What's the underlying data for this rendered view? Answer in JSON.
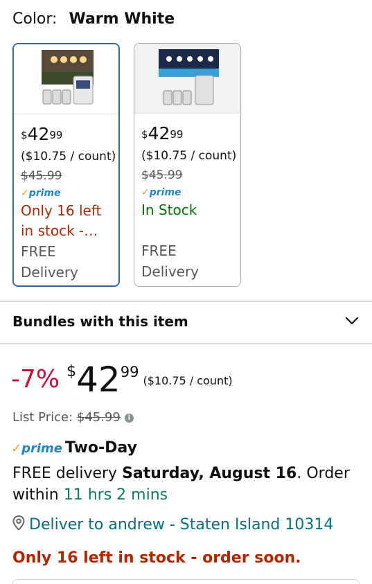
{
  "color": {
    "label": "Color:",
    "value": "Warm White"
  },
  "swatches": [
    {
      "cur": "$",
      "whole": "42",
      "frac": "99",
      "unit": "($10.75 / count)",
      "list": "$45.99",
      "prime": "prime",
      "avail_1": "Only 16 left",
      "avail_2": "in stock -…",
      "ship_1": "FREE",
      "ship_2": "Delivery"
    },
    {
      "cur": "$",
      "whole": "42",
      "frac": "99",
      "unit": "($10.75 / count)",
      "list": "$45.99",
      "prime": "prime",
      "avail_1": "In Stock",
      "ship_1": "FREE",
      "ship_2": "Delivery"
    }
  ],
  "bundles": {
    "label": "Bundles with this item"
  },
  "price": {
    "discount": "-7%",
    "cur": "$",
    "whole": "42",
    "frac": "99",
    "unit": "($10.75 / count)",
    "list_label": "List Price:",
    "list_value": "$45.99"
  },
  "delivery": {
    "prime": "prime",
    "speed": "Two-Day",
    "text_1": "FREE delivery ",
    "date": "Saturday, August 16",
    "text_2": ". Order within ",
    "countdown": "11 hrs 2 mins"
  },
  "deliver_to": "Deliver to andrew - Staten Island 10314",
  "stock_notice": "Only 16 left in stock - order soon.",
  "colors": {
    "link": "#007185",
    "deal_red": "#cc0c39",
    "selected_border": "#2a6aa8",
    "prime_blue": "#1e88c6"
  }
}
